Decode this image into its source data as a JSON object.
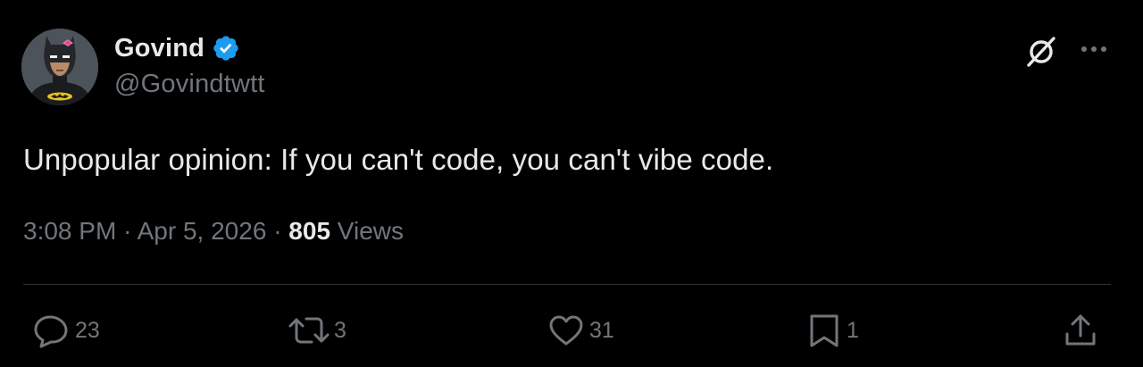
{
  "author": {
    "display_name": "Govind",
    "handle": "@Govindtwtt",
    "verified": true,
    "verified_color": "#1d9bf0"
  },
  "tweet": {
    "text": "Unpopular opinion: If you can't code, you can't vibe code.",
    "time": "3:08 PM",
    "date": "Apr 5, 2026",
    "separator": "·",
    "views_count": "805",
    "views_label": "Views"
  },
  "actions": {
    "replies": "23",
    "reposts": "3",
    "likes": "31",
    "bookmarks": "1"
  },
  "icons": {
    "grok": "grok-icon",
    "more": "more-options-icon",
    "reply": "reply-icon",
    "repost": "repost-icon",
    "like": "heart-icon",
    "bookmark": "bookmark-icon",
    "share": "share-icon"
  },
  "colors": {
    "background": "#000000",
    "primary_text": "#e7e9ea",
    "secondary_text": "#71767b",
    "divider": "#2f3336"
  }
}
